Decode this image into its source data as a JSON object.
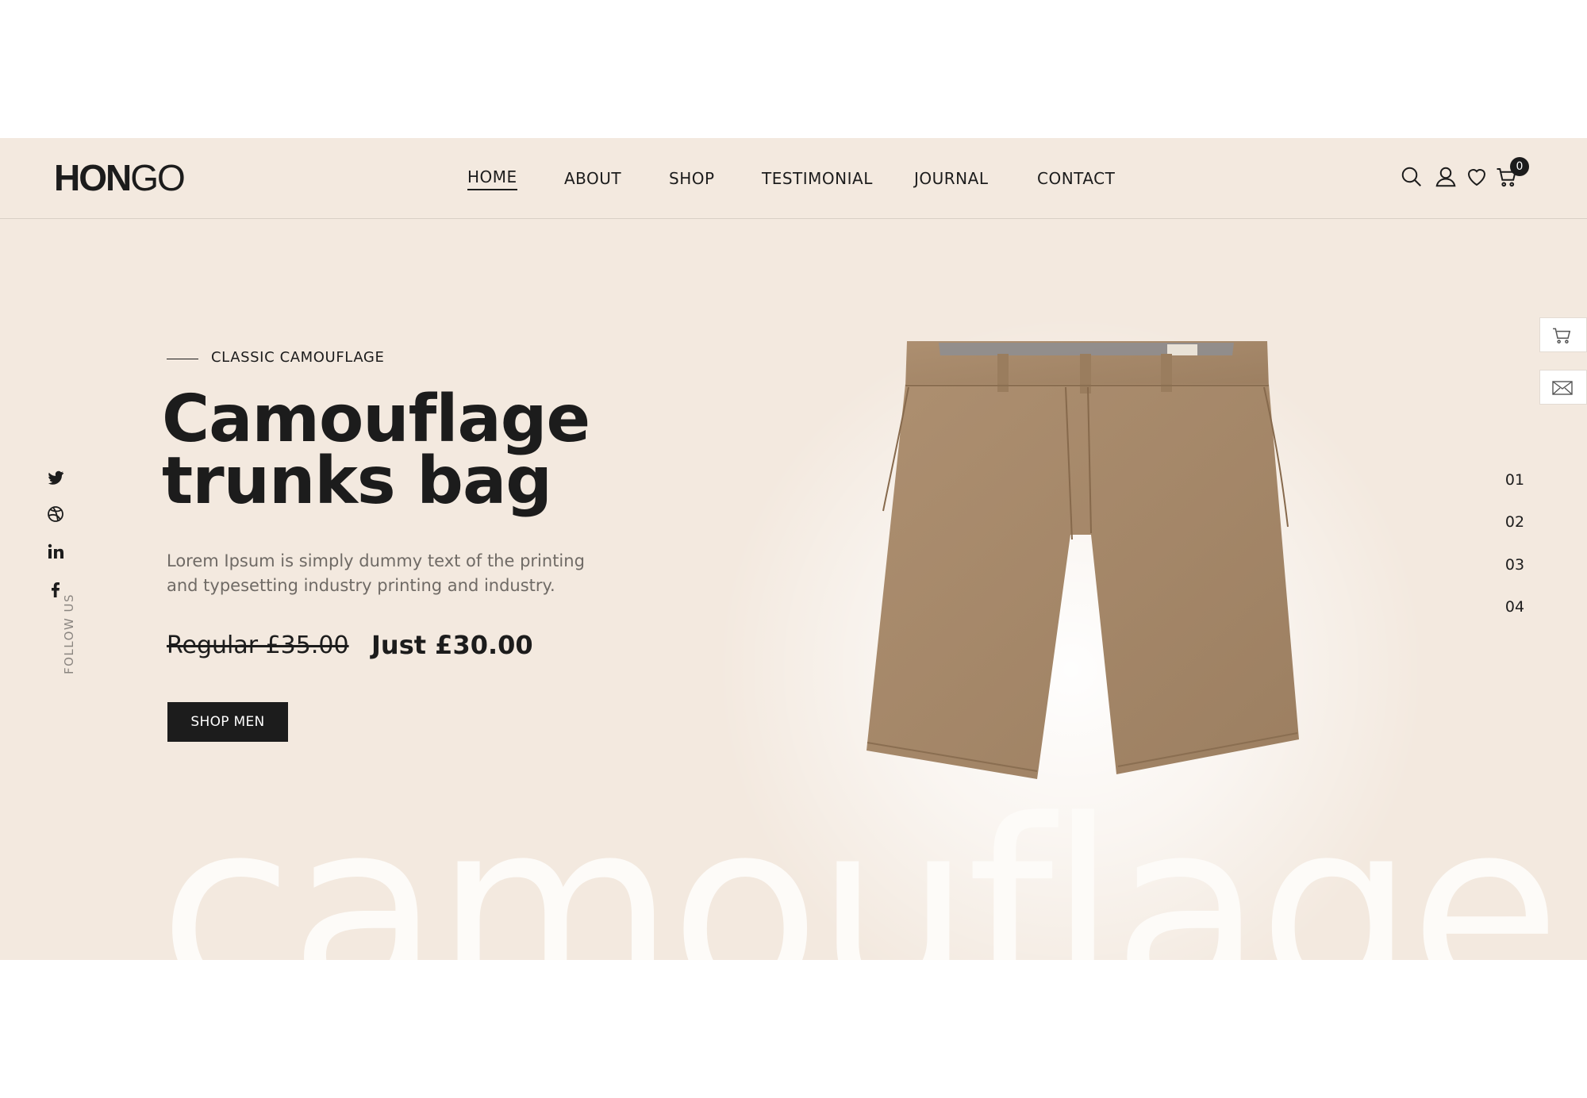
{
  "brand": {
    "logo_bold": "HON",
    "logo_light": "GO"
  },
  "nav": {
    "items": [
      {
        "label": "HOME",
        "active": true
      },
      {
        "label": "ABOUT",
        "active": false
      },
      {
        "label": "SHOP",
        "active": false
      },
      {
        "label": "TESTIMONIAL",
        "active": false
      },
      {
        "label": "JOURNAL",
        "active": false
      },
      {
        "label": "CONTACT",
        "active": false
      }
    ]
  },
  "header_icons": [
    "search-icon",
    "user-icon",
    "heart-icon",
    "cart-icon"
  ],
  "cart": {
    "count": "0"
  },
  "hero": {
    "subtitle": "CLASSIC CAMOUFLAGE",
    "headline_line1": "Camouflage",
    "headline_line2": "trunks bag",
    "description": "Lorem Ipsum is simply dummy text of the printing and typesetting industry printing and industry.",
    "old_price": "Regular £35.00",
    "new_price": "Just £30.00",
    "button_label": "SHOP MEN",
    "watermark": "camouflage"
  },
  "social": {
    "icons": [
      "twitter-icon",
      "dribbble-icon",
      "linkedin-icon",
      "facebook-icon"
    ],
    "follow_label": "FOLLOW US"
  },
  "slider": {
    "numbers": [
      "01",
      "02",
      "03",
      "04"
    ],
    "active_index": 3
  },
  "side_widgets": [
    "cart-icon",
    "mail-icon"
  ],
  "colors": {
    "background": "#f3e9df",
    "text": "#1c1c1c",
    "muted": "#6f6a65",
    "product": "#a4876a"
  }
}
